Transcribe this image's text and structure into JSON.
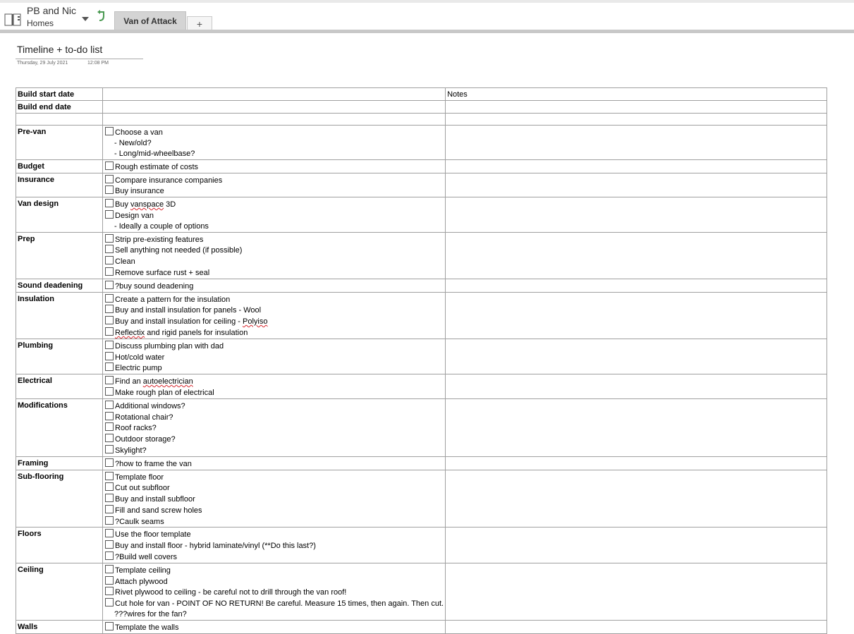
{
  "app": {
    "notebook_name": "PB and Nic",
    "section_name": "Homes",
    "active_tab": "Van of Attack",
    "add_tab_label": "+"
  },
  "page": {
    "title": "Timeline + to-do list",
    "date": "Thursday, 29 July 2021",
    "time": "12:08 PM"
  },
  "table": {
    "header_rows": [
      {
        "label": "Build start date",
        "value": "",
        "notes": "Notes"
      },
      {
        "label": "Build end date",
        "value": "",
        "notes": ""
      },
      {
        "label": "",
        "value": "",
        "notes": ""
      }
    ],
    "sections": [
      {
        "category": "Pre-van",
        "items": [
          {
            "text": "Choose a van",
            "type": "check"
          },
          {
            "text": "New/old?",
            "type": "sub"
          },
          {
            "text": "Long/mid-wheelbase?",
            "type": "sub"
          }
        ]
      },
      {
        "category": "Budget",
        "items": [
          {
            "text": "Rough estimate of costs",
            "type": "check"
          }
        ]
      },
      {
        "category": "Insurance",
        "items": [
          {
            "text": "Compare insurance companies",
            "type": "check"
          },
          {
            "text": "Buy insurance",
            "type": "check"
          }
        ]
      },
      {
        "category": "Van design",
        "items": [
          {
            "text": "Buy vanspace 3D",
            "type": "check"
          },
          {
            "text": "Design van",
            "type": "check"
          },
          {
            "text": "Ideally a couple of options",
            "type": "sub"
          }
        ]
      },
      {
        "category": "Prep",
        "items": [
          {
            "text": "Strip pre-existing features",
            "type": "check"
          },
          {
            "text": "Sell anything not needed (if possible)",
            "type": "check"
          },
          {
            "text": "Clean",
            "type": "check"
          },
          {
            "text": "Remove surface rust + seal",
            "type": "check"
          }
        ]
      },
      {
        "category": "Sound deadening",
        "items": [
          {
            "text": "?buy sound deadening",
            "type": "check"
          }
        ]
      },
      {
        "category": "Insulation",
        "items": [
          {
            "text": "Create a pattern for the insulation",
            "type": "check"
          },
          {
            "text": "Buy and install insulation for panels - Wool",
            "type": "check"
          },
          {
            "text": "Buy and install insulation for ceiling - Polyiso",
            "type": "check"
          },
          {
            "text": "Reflectix and rigid panels for insulation",
            "type": "check"
          }
        ]
      },
      {
        "category": "Plumbing",
        "items": [
          {
            "text": "Discuss plumbing plan with dad",
            "type": "check"
          },
          {
            "text": "Hot/cold water",
            "type": "check"
          },
          {
            "text": "Electric pump",
            "type": "check"
          }
        ]
      },
      {
        "category": "Electrical",
        "items": [
          {
            "text": "Find an autoelectrician",
            "type": "check"
          },
          {
            "text": "Make rough plan of electrical",
            "type": "check"
          }
        ]
      },
      {
        "category": "Modifications",
        "items": [
          {
            "text": "Additional windows?",
            "type": "check"
          },
          {
            "text": "Rotational chair?",
            "type": "check"
          },
          {
            "text": "Roof racks?",
            "type": "check"
          },
          {
            "text": "Outdoor storage?",
            "type": "check"
          },
          {
            "text": "Skylight?",
            "type": "check"
          }
        ]
      },
      {
        "category": "Framing",
        "items": [
          {
            "text": "?how to frame the van",
            "type": "check"
          }
        ]
      },
      {
        "category": "Sub-flooring",
        "items": [
          {
            "text": "Template floor",
            "type": "check"
          },
          {
            "text": "Cut out subfloor",
            "type": "check"
          },
          {
            "text": "Buy and install subfloor",
            "type": "check"
          },
          {
            "text": "Fill and sand screw holes",
            "type": "check"
          },
          {
            "text": "?Caulk seams",
            "type": "check"
          }
        ]
      },
      {
        "category": "Floors",
        "items": [
          {
            "text": "Use the floor template",
            "type": "check"
          },
          {
            "text": "Buy and install floor - hybrid laminate/vinyl (**Do this last?)",
            "type": "check"
          },
          {
            "text": "?Build well covers",
            "type": "check"
          }
        ]
      },
      {
        "category": "Ceiling",
        "items": [
          {
            "text": "Template ceiling",
            "type": "check"
          },
          {
            "text": "Attach plywood",
            "type": "check"
          },
          {
            "text": "Rivet plywood to ceiling - be careful not to drill through the van roof!",
            "type": "check"
          },
          {
            "text": "Cut hole for van - POINT OF NO RETURN! Be careful.  Measure 15 times, then again. Then cut.",
            "type": "check"
          },
          {
            "text": "???wires for the fan?",
            "type": "plain"
          }
        ]
      },
      {
        "category": "Walls",
        "items": [
          {
            "text": "Template the walls",
            "type": "check"
          }
        ]
      }
    ]
  }
}
